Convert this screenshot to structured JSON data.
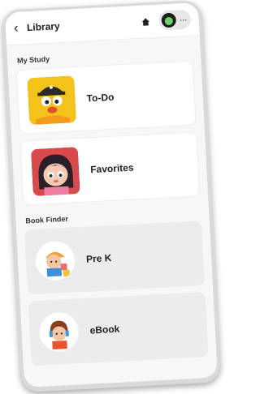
{
  "header": {
    "title": "Library",
    "back_icon": "chevron-left-icon",
    "home_icon": "home-icon",
    "more_label": "···"
  },
  "my_study": {
    "section_title": "My Study",
    "items": [
      {
        "label": "To-Do"
      },
      {
        "label": "Favorites"
      }
    ]
  },
  "book_finder": {
    "section_title": "Book Finder",
    "items": [
      {
        "label": "Pre K"
      },
      {
        "label": "eBook"
      }
    ]
  },
  "colors": {
    "todo_bg": "#f3c21b",
    "favorites_bg": "#d84a4c",
    "card_grey": "#ececee"
  }
}
